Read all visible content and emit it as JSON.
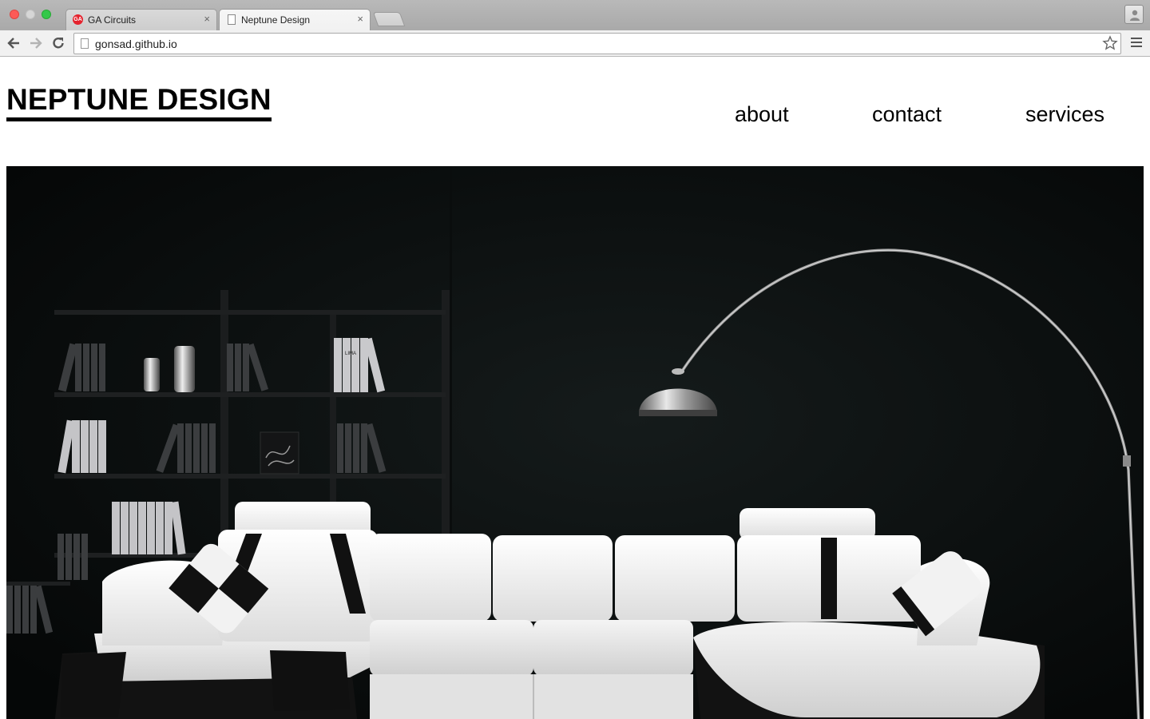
{
  "browser": {
    "tabs": [
      {
        "title": "GA Circuits",
        "favicon": "ga-logo-icon",
        "active": false
      },
      {
        "title": "Neptune Design",
        "favicon": "page-icon",
        "active": true
      }
    ],
    "url": "gonsad.github.io"
  },
  "site": {
    "logo": "NEPTUNE DESIGN",
    "nav": [
      {
        "label": "about"
      },
      {
        "label": "contact"
      },
      {
        "label": "services"
      }
    ]
  },
  "hero": {
    "description_icon": "living-room-photo",
    "book_label": "LIMA",
    "colors": {
      "background": "#070909",
      "sofa": "#f0f0ee",
      "accent": "#101010"
    }
  }
}
